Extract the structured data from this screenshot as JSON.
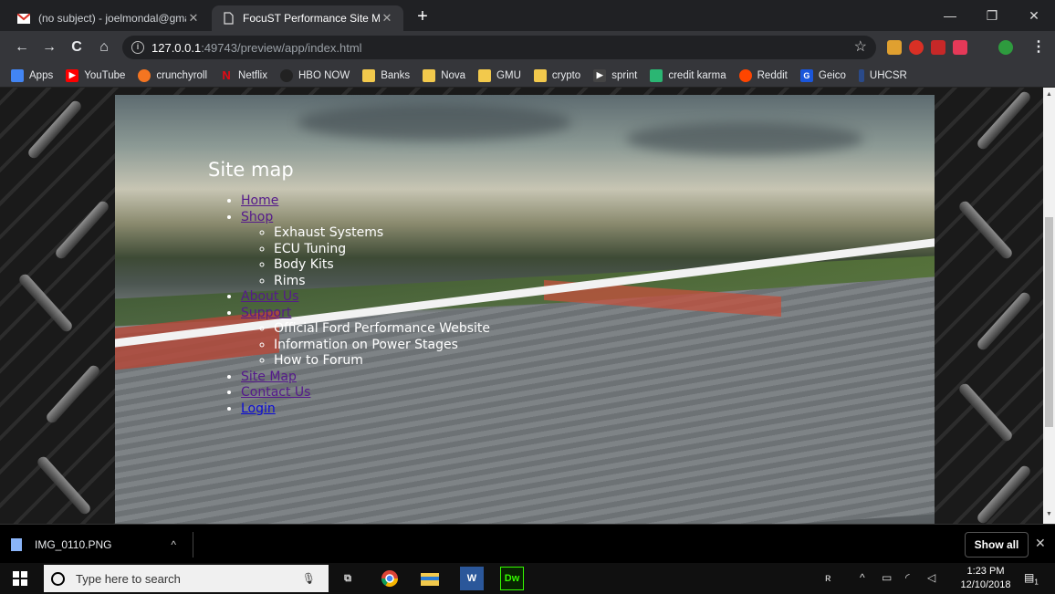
{
  "browser": {
    "tabs": [
      {
        "title": "(no subject) - joelmondal@gmail",
        "favicon": "gmail-icon"
      },
      {
        "title": "FocuST Performance Site Map",
        "favicon": "page-icon"
      }
    ],
    "url_host": "127.0.0.1",
    "url_path": ":49743/preview/app/index.html",
    "bookmarks": [
      {
        "label": "Apps",
        "icon": "apps-grid-icon",
        "color": "#4285f4"
      },
      {
        "label": "YouTube",
        "icon": "youtube-icon",
        "color": "#ff0000"
      },
      {
        "label": "crunchyroll",
        "icon": "crunchyroll-icon",
        "color": "#f47521"
      },
      {
        "label": "Netflix",
        "icon": "netflix-icon",
        "color": "#e50914"
      },
      {
        "label": "HBO NOW",
        "icon": "hbo-icon",
        "color": "#000000"
      },
      {
        "label": "Banks",
        "icon": "folder-icon",
        "color": "#f2c94c"
      },
      {
        "label": "Nova",
        "icon": "folder-icon",
        "color": "#f2c94c"
      },
      {
        "label": "GMU",
        "icon": "folder-icon",
        "color": "#f2c94c"
      },
      {
        "label": "crypto",
        "icon": "folder-icon",
        "color": "#f2c94c"
      },
      {
        "label": "sprint",
        "icon": "sprint-icon",
        "color": "#444444"
      },
      {
        "label": "credit karma",
        "icon": "credit-karma-icon",
        "color": "#2bb673"
      },
      {
        "label": "Reddit",
        "icon": "reddit-icon",
        "color": "#ff4500"
      },
      {
        "label": "Geico",
        "icon": "geico-icon",
        "color": "#1a56db"
      },
      {
        "label": "UHCSR",
        "icon": "uhcsr-icon",
        "color": "#2a4a8a"
      }
    ]
  },
  "page": {
    "heading": "Site map",
    "items": [
      {
        "label": "Home",
        "link": true,
        "children": []
      },
      {
        "label": "Shop",
        "link": true,
        "children": [
          "Exhaust Systems",
          "ECU Tuning",
          "Body Kits",
          "Rims"
        ]
      },
      {
        "label": "About Us",
        "link": true,
        "children": []
      },
      {
        "label": "Support",
        "link": true,
        "children": [
          "Official Ford Performance Website",
          "Information on Power Stages",
          "How to Forum"
        ]
      },
      {
        "label": "Site Map",
        "link": true,
        "children": []
      },
      {
        "label": "Contact Us",
        "link": true,
        "children": []
      },
      {
        "label": "Login",
        "link": true,
        "children": []
      }
    ]
  },
  "downloads": {
    "file": "IMG_0110.PNG",
    "show_all": "Show all"
  },
  "taskbar": {
    "search_placeholder": "Type here to search",
    "apps": [
      {
        "name": "chrome-icon",
        "label": ""
      },
      {
        "name": "file-explorer-icon",
        "label": ""
      },
      {
        "name": "word-icon",
        "label": "W"
      },
      {
        "name": "dreamweaver-icon",
        "label": "Dw"
      }
    ],
    "time": "1:23 PM",
    "date": "12/10/2018",
    "notification_count": "1"
  }
}
